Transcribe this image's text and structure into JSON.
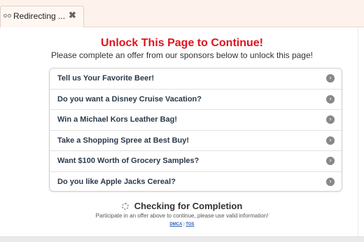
{
  "tab": {
    "title": "Redirecting ...",
    "close_glyph": "✖",
    "icon": "loading-dots-icon"
  },
  "header": {
    "title": "Unlock This Page to Continue!",
    "subtitle": "Please complete an offer from our sponsors below to unlock this page!"
  },
  "offers": [
    {
      "label": "Tell us Your Favorite Beer!",
      "icon": "chevron-right-icon"
    },
    {
      "label": "Do you want a Disney Cruise Vacation?",
      "icon": "chevron-right-icon"
    },
    {
      "label": "Win a Michael Kors Leather Bag!",
      "icon": "chevron-right-icon"
    },
    {
      "label": "Take a Shopping Spree at Best Buy!",
      "icon": "chevron-right-icon"
    },
    {
      "label": "Want $100 Worth of Grocery Samples?",
      "icon": "chevron-right-icon"
    },
    {
      "label": "Do you like Apple Jacks Cereal?",
      "icon": "chevron-right-icon"
    }
  ],
  "status": {
    "checking": "Checking for Completion",
    "instruction": "Participate in an offer above to continue, please use valid information!",
    "links": {
      "dmca": "DMCA",
      "separator": "|",
      "tos": "TOS"
    }
  },
  "colors": {
    "title_red": "#e0141e",
    "tab_bg": "#fdf3ec",
    "link_blue": "#2a5db0"
  }
}
